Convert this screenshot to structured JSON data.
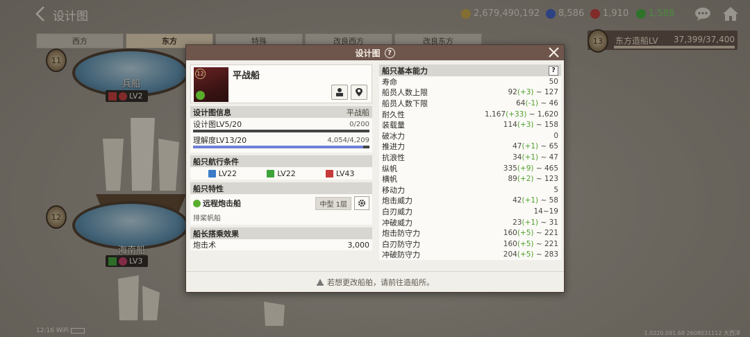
{
  "app": {
    "title": "设计图"
  },
  "resources": [
    {
      "name": "ducats",
      "value": "2,679,490,192",
      "icon": "coin-icon",
      "color": "#c9a647"
    },
    {
      "name": "blue-gem",
      "value": "8,586",
      "icon": "blue-gem-icon",
      "color": "#3e5fc7"
    },
    {
      "name": "red-gem",
      "value": "1,910",
      "icon": "red-gem-icon",
      "color": "#c43b3b"
    },
    {
      "name": "green",
      "value": "1,588",
      "icon": "green-cycle-icon",
      "color": "#3fae3a"
    }
  ],
  "tabs": [
    "西方",
    "东方",
    "特殊",
    "改良西方",
    "改良东方"
  ],
  "active_tab_index": 1,
  "rank": {
    "badge": "13",
    "label": "东方造船LV",
    "value": "37,399/37,400",
    "progress": 0.99997
  },
  "bg_ships": [
    {
      "badge": "11",
      "name": "兵船",
      "level": "LV2"
    },
    {
      "badge": "12",
      "name": "海南船",
      "level": "LV3"
    }
  ],
  "status_bar": {
    "time": "12:16",
    "wifi": "WiFi"
  },
  "build_info": "1.0220.091.68 2608031112 大西洋",
  "modal": {
    "title": "设计图",
    "help": "?",
    "ship": {
      "level_badge": "12",
      "name": "平战船"
    },
    "blueprint": {
      "title": "设计图信息",
      "type": "平战船",
      "design_level": "设计图LV5/20",
      "design_value": "0/200",
      "design_progress": 0.0,
      "understanding_level": "理解度LV13/20",
      "understanding_value": "4,054/4,209",
      "understanding_progress": 0.963
    },
    "sailing": {
      "title": "船只航行条件",
      "conditions": [
        {
          "icon": "adventure-icon",
          "color": "#3b7bc8",
          "label": "LV22"
        },
        {
          "icon": "trade-icon",
          "color": "#3ea33a",
          "label": "LV22"
        },
        {
          "icon": "battle-icon",
          "color": "#c63a3a",
          "label": "LV43"
        }
      ]
    },
    "traits": {
      "title": "船只特性",
      "name": "远程炮击船",
      "size": "中型 1层",
      "sub": "排桨帆船"
    },
    "captain": {
      "title": "船长搭乘效果",
      "skill": "炮击术",
      "value": "3,000"
    },
    "stats": {
      "title": "船只基本能力",
      "help": "?",
      "rows": [
        {
          "label": "寿命",
          "base": "50",
          "plus": "",
          "tail": ""
        },
        {
          "label": "船员人数上限",
          "base": "92",
          "plus": "(+3)",
          "tail": " ~ 127"
        },
        {
          "label": "船员人数下限",
          "base": "64",
          "plus": "(-1)",
          "tail": " ~ 46"
        },
        {
          "label": "耐久性",
          "base": "1,167",
          "plus": "(+33)",
          "tail": " ~ 1,620"
        },
        {
          "label": "装载量",
          "base": "114",
          "plus": "(+3)",
          "tail": " ~ 158"
        },
        {
          "label": "破冰力",
          "base": "0",
          "plus": "",
          "tail": ""
        },
        {
          "label": "推进力",
          "base": "47",
          "plus": "(+1)",
          "tail": " ~ 65"
        },
        {
          "label": "抗浪性",
          "base": "34",
          "plus": "(+1)",
          "tail": " ~ 47"
        },
        {
          "label": "纵帆",
          "base": "335",
          "plus": "(+9)",
          "tail": " ~ 465"
        },
        {
          "label": "横帆",
          "base": "89",
          "plus": "(+2)",
          "tail": " ~ 123"
        },
        {
          "label": "移动力",
          "base": "5",
          "plus": "",
          "tail": ""
        },
        {
          "label": "炮击威力",
          "base": "42",
          "plus": "(+1)",
          "tail": " ~ 58"
        },
        {
          "label": "白刃威力",
          "base": "14~19",
          "plus": "",
          "tail": ""
        },
        {
          "label": "冲破威力",
          "base": "23",
          "plus": "(+1)",
          "tail": " ~ 31"
        },
        {
          "label": "炮击防守力",
          "base": "160",
          "plus": "(+5)",
          "tail": " ~ 221"
        },
        {
          "label": "白刃防守力",
          "base": "160",
          "plus": "(+5)",
          "tail": " ~ 221"
        },
        {
          "label": "冲破防守力",
          "base": "204",
          "plus": "(+5)",
          "tail": " ~ 283"
        }
      ]
    },
    "footer": "若想更改船舶，请前往造船所。"
  }
}
